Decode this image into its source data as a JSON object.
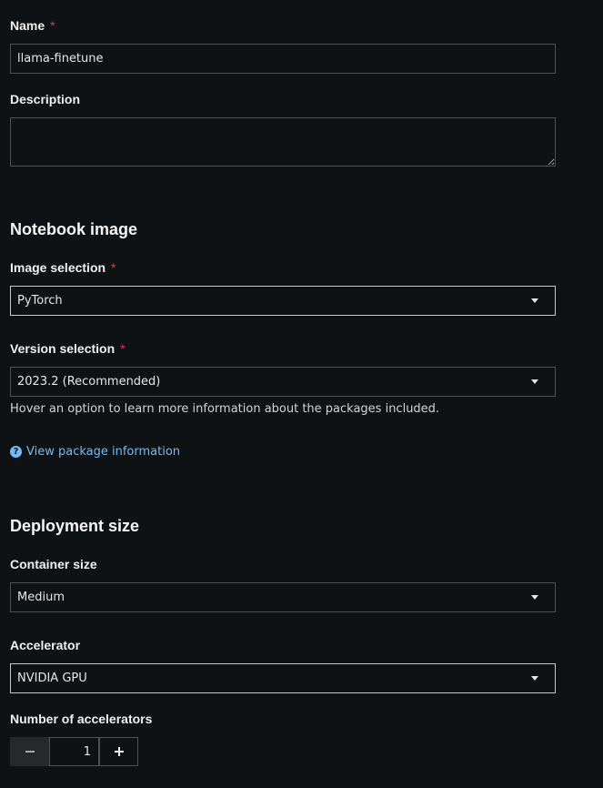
{
  "name": {
    "label": "Name",
    "required_marker": "*",
    "value": "llama-finetune"
  },
  "description": {
    "label": "Description",
    "value": ""
  },
  "notebook_image": {
    "heading": "Notebook image",
    "image_selection": {
      "label": "Image selection",
      "required_marker": "*",
      "selected": "PyTorch"
    },
    "version_selection": {
      "label": "Version selection",
      "required_marker": "*",
      "selected": "2023.2 (Recommended)",
      "helper": "Hover an option to learn more information about the packages included."
    },
    "view_package_link": "View package information",
    "help_icon": "question-circle-icon"
  },
  "deployment_size": {
    "heading": "Deployment size",
    "container_size": {
      "label": "Container size",
      "selected": "Medium"
    },
    "accelerator": {
      "label": "Accelerator",
      "selected": "NVIDIA GPU"
    },
    "num_accelerators": {
      "label": "Number of accelerators",
      "value": "1",
      "minus_icon": "minus-icon",
      "plus_icon": "plus-icon"
    }
  },
  "colors": {
    "background": "#0f1214",
    "required": "#ee3344",
    "link": "#73bcf7",
    "border": "#4f5255",
    "active_border": "#c9c9c9"
  }
}
